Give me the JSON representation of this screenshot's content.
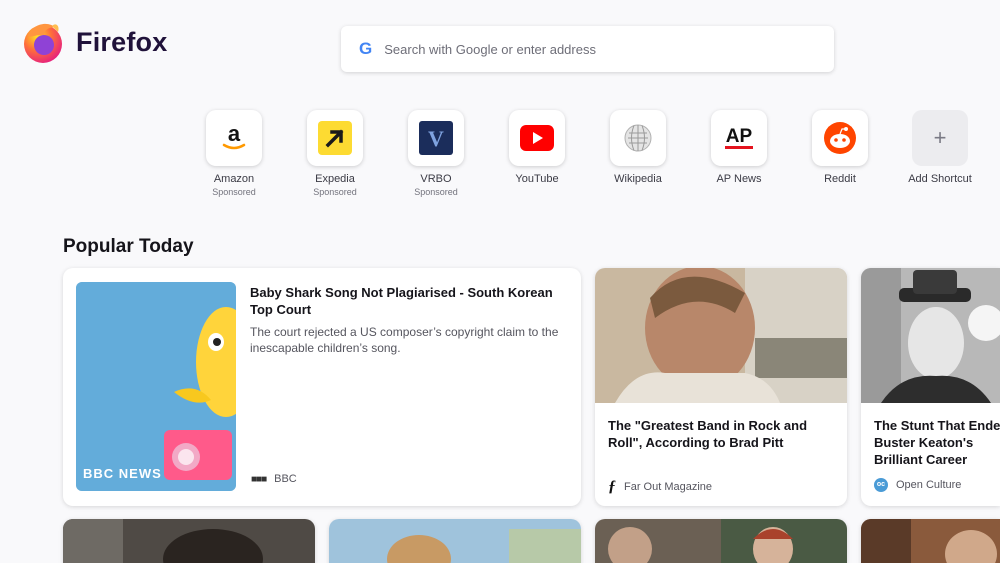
{
  "browser": {
    "name": "Firefox"
  },
  "search": {
    "placeholder": "Search with Google or enter address",
    "engine_letter": "G"
  },
  "shortcuts": [
    {
      "label": "Amazon",
      "sponsored": "Sponsored",
      "icon": "amazon-icon"
    },
    {
      "label": "Expedia",
      "sponsored": "Sponsored",
      "icon": "expedia-icon"
    },
    {
      "label": "VRBO",
      "sponsored": "Sponsored",
      "icon": "vrbo-icon"
    },
    {
      "label": "YouTube",
      "icon": "youtube-icon"
    },
    {
      "label": "Wikipedia",
      "icon": "wikipedia-icon"
    },
    {
      "label": "AP News",
      "icon": "ap-news-icon"
    },
    {
      "label": "Reddit",
      "icon": "reddit-icon"
    },
    {
      "label": "Add Shortcut",
      "icon": "plus-icon"
    }
  ],
  "shortcut_logos": {
    "amazon": "a",
    "ap": "AP",
    "vrbo": "V",
    "add": "+"
  },
  "popular": {
    "title": "Popular Today",
    "stories": [
      {
        "title": "Baby Shark Song Not Plagiarised - South Korean Top Court",
        "excerpt": "The court rejected a US composer’s copyright claim to the inescapable children’s song.",
        "source": "BBC",
        "image_watermark": "BBC NEWS"
      },
      {
        "title": "The \"Greatest Band in Rock and Roll\", According to Brad Pitt",
        "source": "Far Out Magazine"
      },
      {
        "title": "The Stunt That Ended Buster Keaton's Brilliant Career",
        "source": "Open Culture"
      }
    ]
  },
  "colors": {
    "brand_text": "#20123a",
    "youtube": "#ff0000",
    "reddit": "#ff4500",
    "expedia": "#fddb32",
    "vrbo": "#1b2d5b"
  }
}
